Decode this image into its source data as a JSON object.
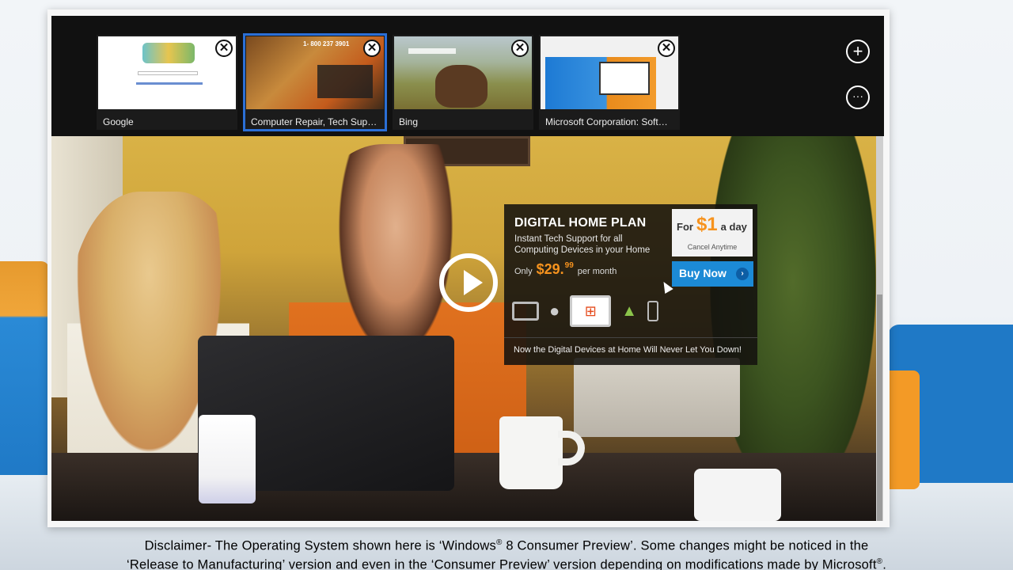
{
  "app_bar": {
    "tabs": [
      {
        "label": "Google",
        "close_glyph": "✕"
      },
      {
        "label": "Computer Repair, Tech Suppor...",
        "close_glyph": "✕",
        "phone": "1- 800 237 3901"
      },
      {
        "label": "Bing",
        "close_glyph": "✕"
      },
      {
        "label": "Microsoft Corporation: Softwar...",
        "close_glyph": "✕"
      }
    ],
    "new_tab_glyph": "+",
    "more_glyph": "···"
  },
  "ad": {
    "title": "DIGITAL HOME PLAN",
    "subtitle": "Instant Tech Support for all Computing Devices in your Home",
    "price_prefix": "Only",
    "price": "$29.",
    "price_cents": "99",
    "price_suffix": "per month",
    "day_for": "For",
    "day_price": "$1",
    "day_suffix": "a day",
    "cancel": "Cancel Anytime",
    "buy": "Buy Now",
    "buy_chevron": "›",
    "footer": "Now the Digital Devices at Home Will Never Let You Down!",
    "device_icons": [
      "tablet-icon",
      "apple-icon",
      "windows-laptop-icon",
      "android-icon",
      "phone-icon"
    ]
  },
  "disclaimer": {
    "line1_a": "Disclaimer- The Operating System shown here is ‘Windows",
    "reg": "®",
    "line1_b": " 8 Consumer Preview’. Some changes might be noticed in the",
    "line2_a": "‘Release to Manufacturing’ version and even in the ‘Consumer Preview’ version depending on modifications made by Microsoft",
    "line2_b": "."
  },
  "colors": {
    "accent": "#2b6fd6",
    "ad_orange": "#f7931e",
    "buy_blue": "#1c8ad6"
  }
}
